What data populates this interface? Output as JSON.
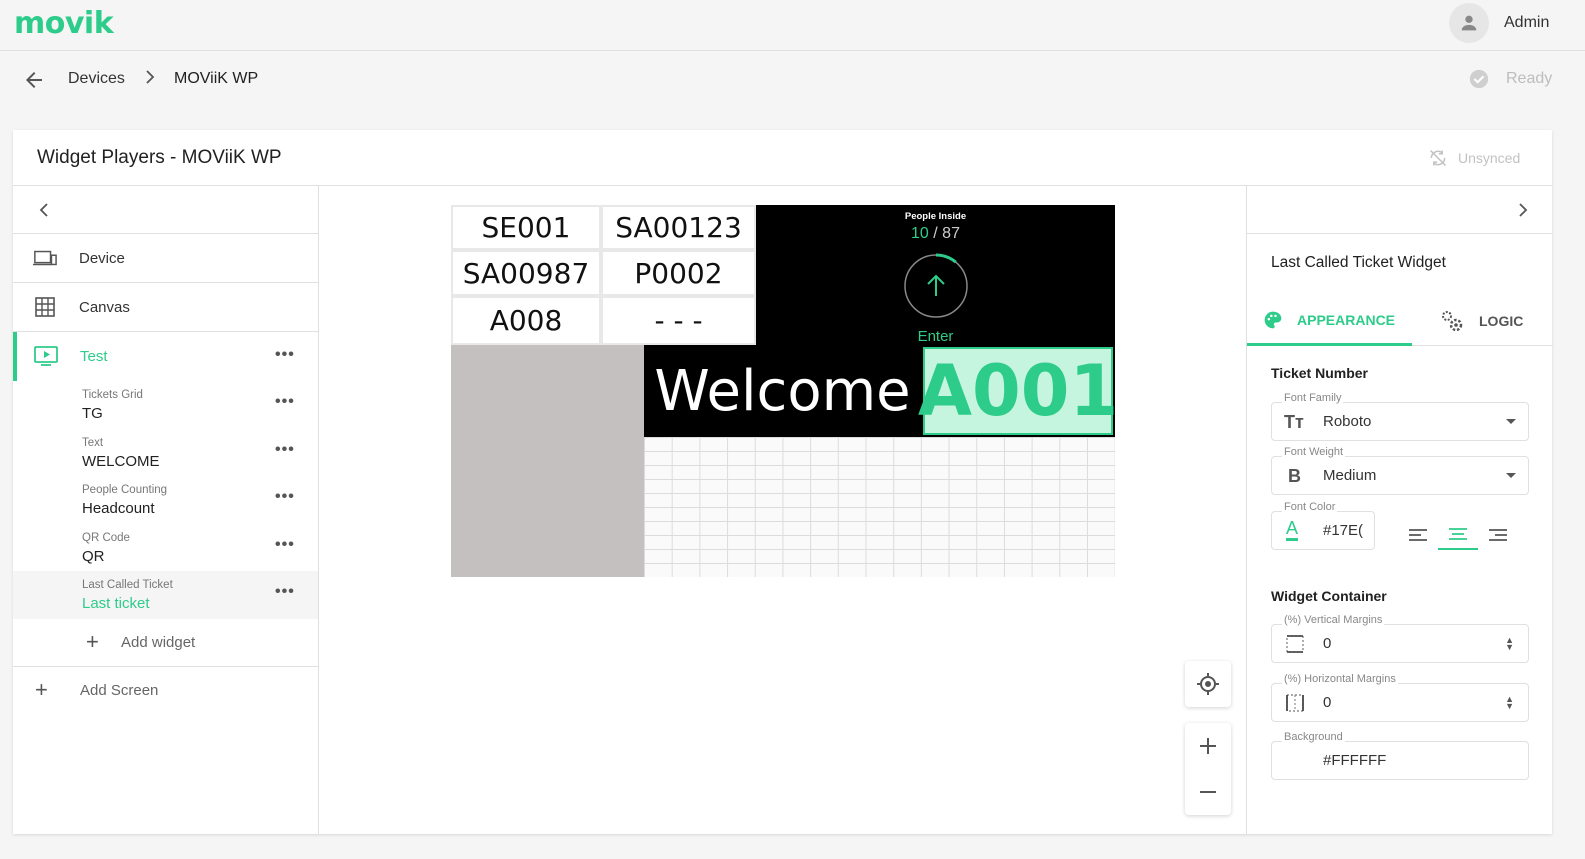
{
  "topbar": {
    "logo": "movik",
    "user": "Admin"
  },
  "breadcrumb": {
    "items": [
      "Devices",
      "MOViiK WP"
    ],
    "separator": "›",
    "status": "Ready"
  },
  "card": {
    "title": "Widget Players -  MOViiK WP",
    "sync_status": "Unsynced"
  },
  "left_nav": {
    "items": [
      {
        "label": "Device"
      },
      {
        "label": "Canvas"
      },
      {
        "label": "Test"
      }
    ],
    "widgets": [
      {
        "type": "Tickets Grid",
        "name": "TG"
      },
      {
        "type": "Text",
        "name": "WELCOME"
      },
      {
        "type": "People Counting",
        "name": "Headcount"
      },
      {
        "type": "QR Code",
        "name": "QR"
      },
      {
        "type": "Last Called Ticket",
        "name": "Last ticket"
      }
    ],
    "more": "•••",
    "add_widget": "Add widget",
    "add_screen": "Add Screen"
  },
  "canvas": {
    "tickets": [
      "SE001",
      "SA00123",
      "SA00987",
      "P0002",
      "A008",
      "- - -"
    ],
    "people_counting": {
      "title": "People Inside",
      "current": "10",
      "separator": " / ",
      "total": "87",
      "direction": "Enter",
      "progress": 0.11
    },
    "welcome_text": "Welcome",
    "last_ticket": "A001"
  },
  "right_panel": {
    "title": "Last Called Ticket Widget",
    "tabs": [
      "APPEARANCE",
      "LOGIC"
    ],
    "ticket_number": {
      "section": "Ticket Number",
      "font_family_label": "Font Family",
      "font_family": "Roboto",
      "font_weight_label": "Font Weight",
      "font_weight": "Medium",
      "font_color_label": "Font Color",
      "font_color": "#17E(",
      "font_icon": "Tт",
      "bold_icon": "B",
      "color_icon": "A"
    },
    "widget_container": {
      "section": "Widget Container",
      "vertical_label": "(%) Vertical Margins",
      "vertical": "0",
      "horizontal_label": "(%) Horizontal Margins",
      "horizontal": "0",
      "background_label": "Background",
      "background": "#FFFFFF"
    }
  },
  "colors": {
    "accent": "#2ecc8a",
    "grey_qr": "#c4c0bf"
  }
}
